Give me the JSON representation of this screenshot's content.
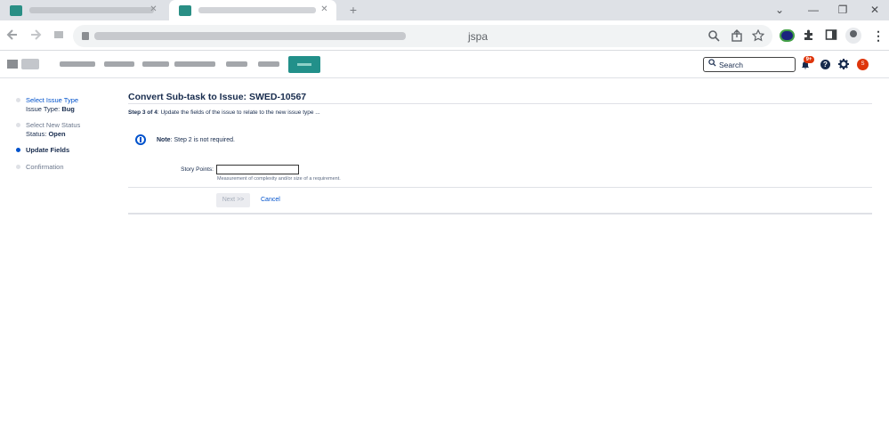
{
  "browser": {
    "close_glyph": "✕",
    "new_tab_glyph": "+",
    "window_controls": {
      "minimize": "—",
      "restore": "❐",
      "close": "✕",
      "chevron": "⌄"
    },
    "url_tail": "jspa",
    "icons": [
      "zoom-icon",
      "share-icon",
      "bookmark-star-icon",
      "extensions-puzzle-icon",
      "side-panel-icon",
      "profile-icon",
      "more-menu-icon"
    ]
  },
  "header": {
    "search_placeholder": "Search",
    "notifications_badge": "9+",
    "help_glyph": "?",
    "avatar_initial": "S"
  },
  "steps": [
    {
      "label": "Select Issue Type",
      "sub_label": "Issue Type:",
      "sub_value": "Bug",
      "state": "link"
    },
    {
      "label": "Select New Status",
      "sub_label": "Status:",
      "sub_value": "Open",
      "state": "done"
    },
    {
      "label": "Update Fields",
      "state": "current"
    },
    {
      "label": "Confirmation",
      "state": "pending"
    }
  ],
  "main": {
    "title": "Convert Sub-task to Issue: SWED-10567",
    "step_caption_bold": "Step 3 of 4",
    "step_caption_rest": ": Update the fields of the issue to relate to the new issue type ...",
    "note_bold": "Note",
    "note_rest": ": Step 2 is not required.",
    "field": {
      "label": "Story Points:",
      "value": "",
      "description": "Measurement of complexity and/or size of a requirement."
    },
    "next_label": "Next >>",
    "cancel_label": "Cancel"
  },
  "colors": {
    "accent": "#0052cc",
    "brand": "#22908a",
    "danger": "#de350b",
    "text": "#172b4d"
  }
}
